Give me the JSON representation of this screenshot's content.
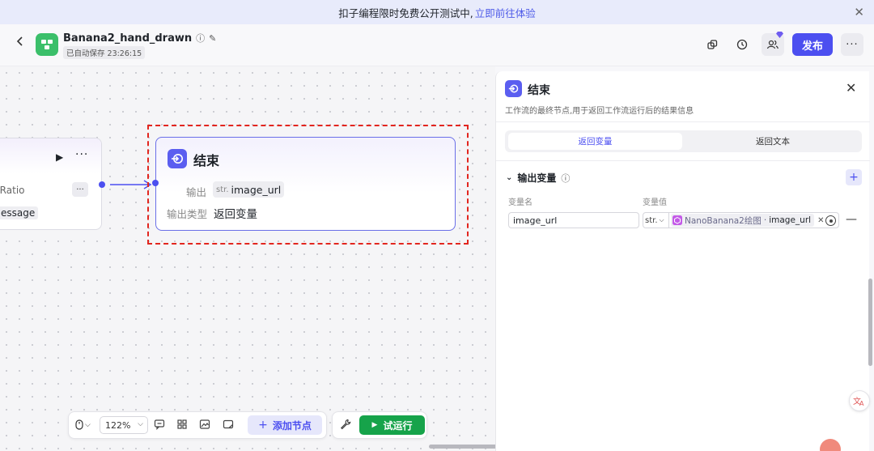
{
  "banner": {
    "text": "扣子编程限时免费公开测试中,",
    "link": "立即前往体验"
  },
  "header": {
    "app_name": "Banana2_hand_drawn",
    "saved": "已自动保存 23:26:15",
    "publish": "发布"
  },
  "canvas": {
    "prev_node": {
      "field1": "ectRatio",
      "field2": "essage"
    },
    "end_node": {
      "title": "结束",
      "output_label": "输出",
      "output_type": "str.",
      "output_value": "image_url",
      "output_kind_label": "输出类型",
      "output_kind_value": "返回变量"
    }
  },
  "toolbar": {
    "zoom": "122%",
    "add_node": "添加节点",
    "test_run": "试运行"
  },
  "panel": {
    "title": "结束",
    "description": "工作流的最终节点,用于返回工作流运行后的结果信息",
    "tab_active": "返回变量",
    "tab_inactive": "返回文本",
    "section": "输出变量",
    "col_name": "变量名",
    "col_value": "变量值",
    "var_name": "image_url",
    "var_type": "str.",
    "ref_source": "NanoBanana2绘图",
    "ref_sep": "·",
    "ref_field": "image_url"
  },
  "colors": {
    "accent": "#4c4ff0",
    "run": "#16a34a",
    "highlight": "#e2261f",
    "app_icon": "#3bbf6a"
  }
}
